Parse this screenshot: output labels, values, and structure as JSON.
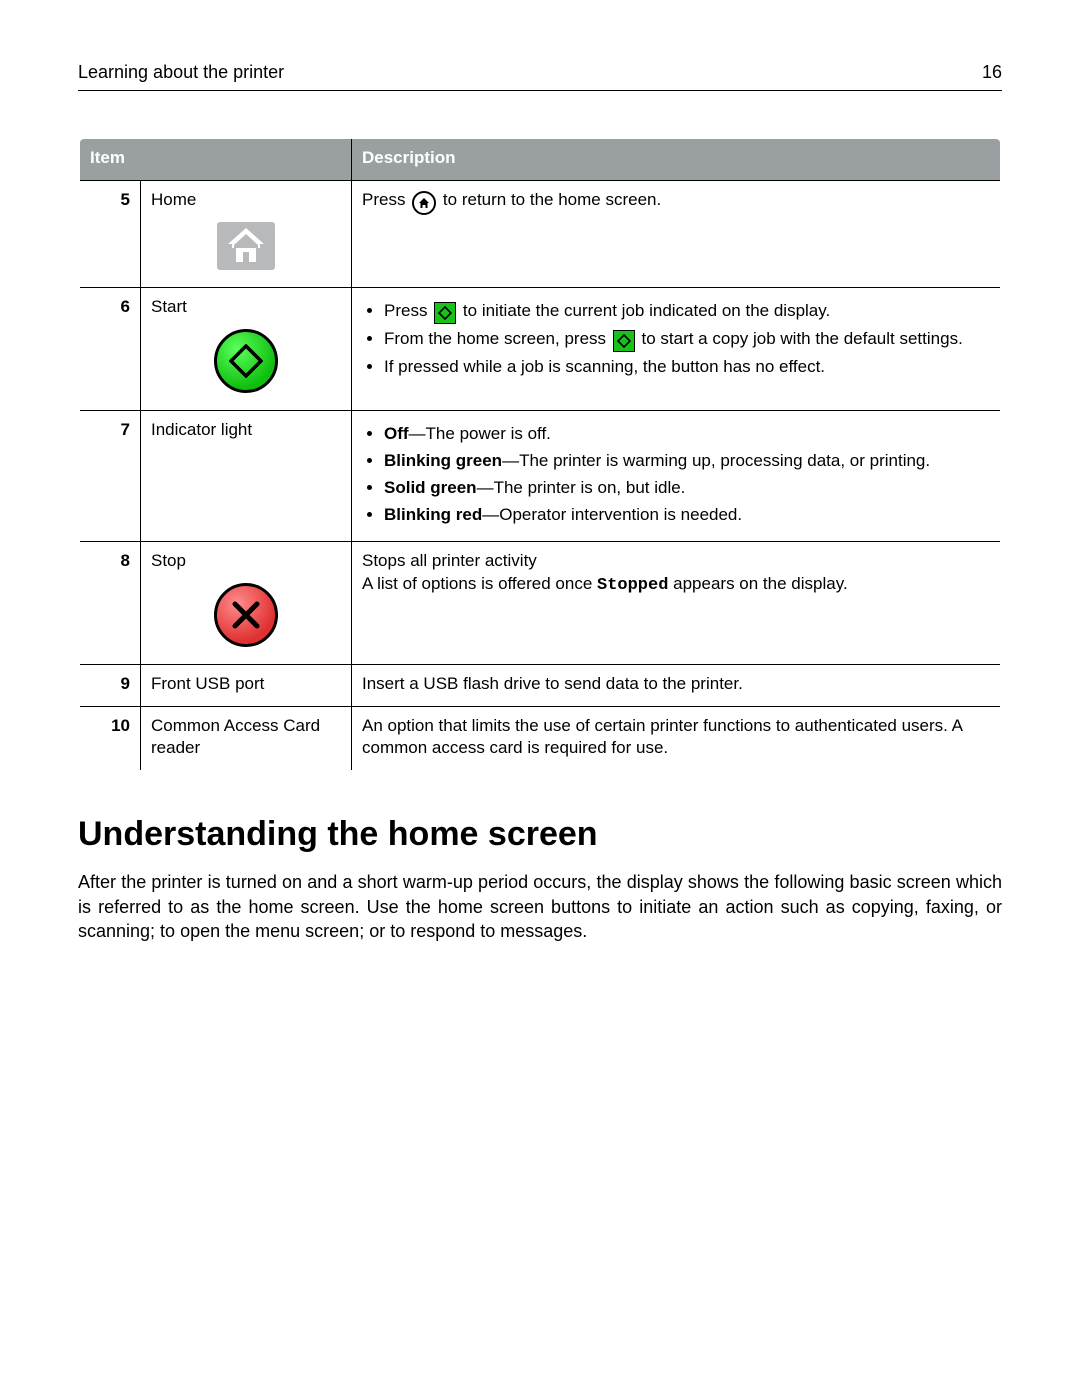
{
  "header": {
    "title": "Learning about the printer",
    "page_number": "16"
  },
  "table": {
    "col_item": "Item",
    "col_desc": "Description",
    "rows": [
      {
        "num": "5",
        "name": "Home",
        "desc_before": "Press ",
        "desc_after": " to return to the home screen."
      },
      {
        "num": "6",
        "name": "Start",
        "b1_before": "Press ",
        "b1_after": " to initiate the current job indicated on the display.",
        "b2_before": "From the home screen, press ",
        "b2_after": " to start a copy job with the default settings.",
        "b3": "If pressed while a job is scanning, the button has no effect."
      },
      {
        "num": "7",
        "name": "Indicator light",
        "s1_label": "Off",
        "s1_text": "—The power is off.",
        "s2_label": "Blinking green",
        "s2_text": "—The printer is warming up, processing data, or printing.",
        "s3_label": "Solid green",
        "s3_text": "—The printer is on, but idle.",
        "s4_label": "Blinking red",
        "s4_text": "—Operator intervention is needed."
      },
      {
        "num": "8",
        "name": "Stop",
        "line1": "Stops all printer activity",
        "line2_before": "A list of options is offered once ",
        "line2_code": "Stopped",
        "line2_after": " appears on the display."
      },
      {
        "num": "9",
        "name": "Front USB port",
        "desc": "Insert a USB flash drive to send data to the printer."
      },
      {
        "num": "10",
        "name": "Common Access Card reader",
        "desc": "An option that limits the use of certain printer functions to authenticated users. A common access card is required for use."
      }
    ]
  },
  "section": {
    "title": "Understanding the home screen",
    "body": "After the printer is turned on and a short warm-up period occurs, the display shows the following basic screen which is referred to as the home screen. Use the home screen buttons to initiate an action such as copying, faxing, or scanning; to open the menu screen; or to respond to messages."
  }
}
